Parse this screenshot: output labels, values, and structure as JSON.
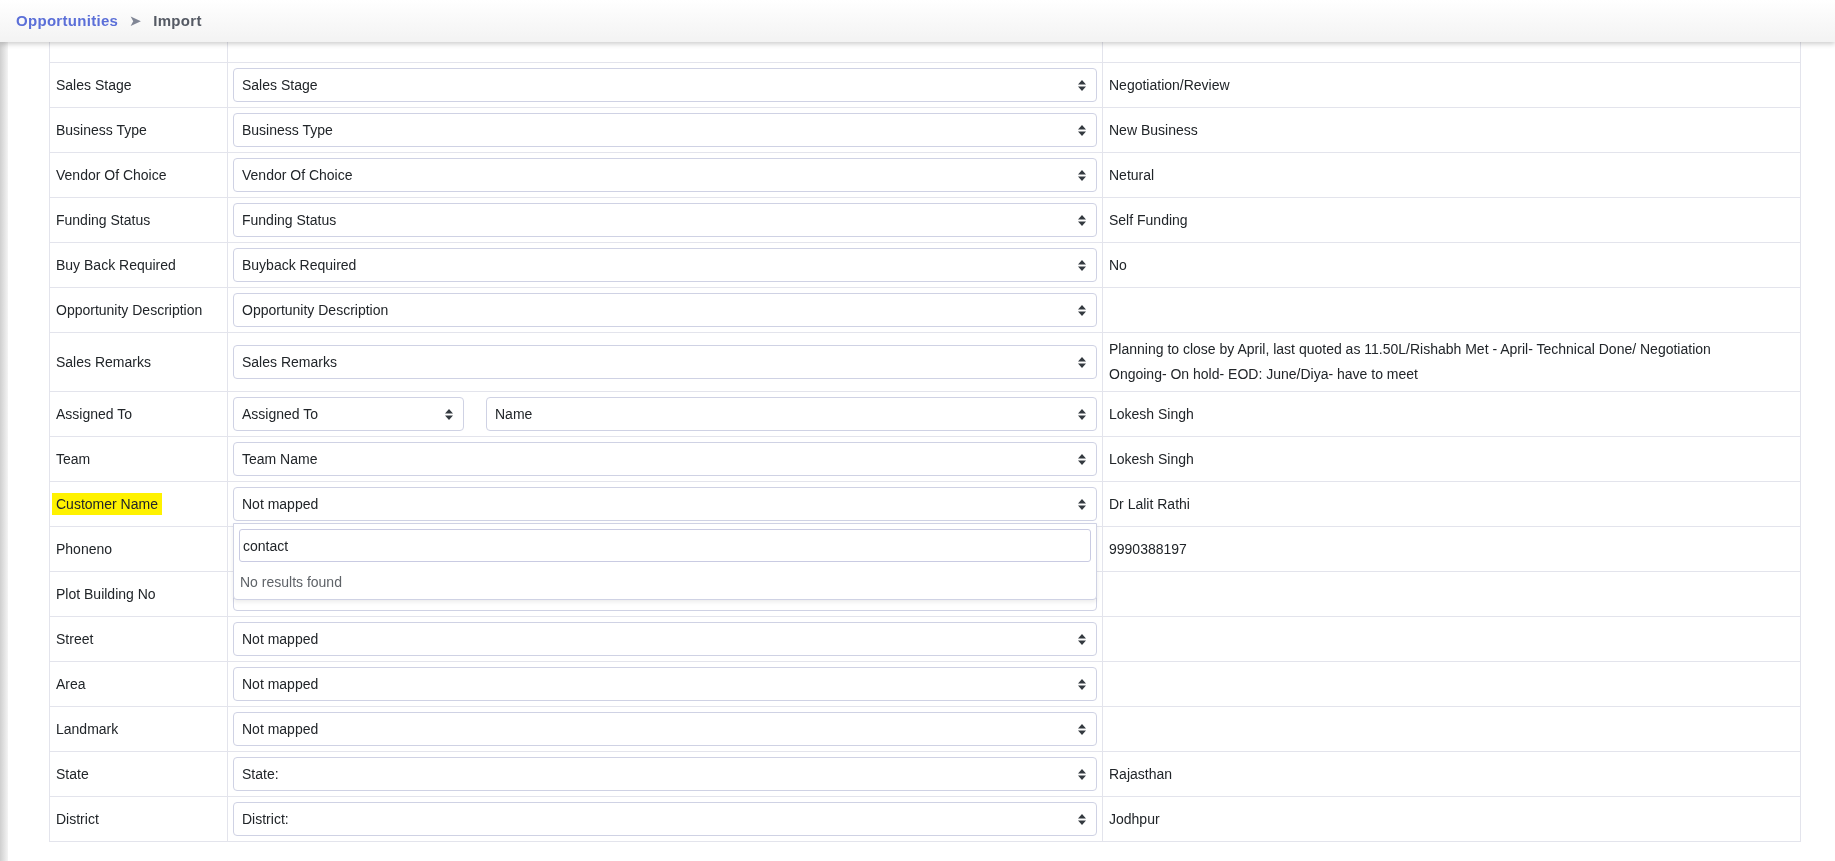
{
  "breadcrumb": [
    {
      "label": "Opportunities",
      "kind": "link"
    },
    {
      "label": "➤",
      "kind": "separator"
    },
    {
      "label": "Import",
      "kind": "current"
    }
  ],
  "rows": [
    {
      "label": "Sales Stage",
      "highlighted": false,
      "selects": [
        {
          "value": "Sales Stage"
        }
      ],
      "sample": "Negotiation/Review"
    },
    {
      "label": "Business Type",
      "highlighted": false,
      "selects": [
        {
          "value": "Business Type"
        }
      ],
      "sample": "New Business"
    },
    {
      "label": "Vendor Of Choice",
      "highlighted": false,
      "selects": [
        {
          "value": "Vendor Of Choice"
        }
      ],
      "sample": "Netural"
    },
    {
      "label": "Funding Status",
      "highlighted": false,
      "selects": [
        {
          "value": "Funding Status"
        }
      ],
      "sample": "Self Funding"
    },
    {
      "label": "Buy Back Required",
      "highlighted": false,
      "selects": [
        {
          "value": "Buyback Required"
        }
      ],
      "sample": "No"
    },
    {
      "label": "Opportunity Description",
      "highlighted": false,
      "selects": [
        {
          "value": "Opportunity Description"
        }
      ]
    },
    {
      "label": "Sales Remarks",
      "highlighted": false,
      "selects": [
        {
          "value": "Sales Remarks"
        }
      ],
      "sample": "Planning to close by April, last quoted as 11.50L/Rishabh Met - April- Technical Done/ Negotiation Ongoing- On hold- EOD: June/Diya- have to meet"
    },
    {
      "label": "Assigned To",
      "highlighted": false,
      "selects": [
        {
          "value": "Assigned To"
        },
        {
          "value": "Name"
        }
      ],
      "sample": "Lokesh Singh"
    },
    {
      "label": "Team",
      "highlighted": false,
      "selects": [
        {
          "value": "Team Name"
        }
      ],
      "sample": "Lokesh Singh"
    },
    {
      "label": "Customer Name",
      "highlighted": true,
      "selects": [
        {
          "value": "Not mapped",
          "dropdown": {
            "search": "contact",
            "message": "No results found"
          }
        }
      ],
      "sample": "Dr Lalit Rathi"
    },
    {
      "label": "Phoneno",
      "highlighted": false,
      "selects": [],
      "sample": "9990388197"
    },
    {
      "label": "Plot Building No",
      "highlighted": false,
      "selects": [
        {
          "kind": "select"
        }
      ]
    },
    {
      "label": "Street",
      "highlighted": false,
      "selects": [
        {
          "value": "Not mapped"
        }
      ]
    },
    {
      "label": "Area",
      "highlighted": false,
      "selects": [
        {
          "value": "Not mapped"
        }
      ]
    },
    {
      "label": "Landmark",
      "highlighted": false,
      "selects": [
        {
          "value": "Not mapped"
        }
      ]
    },
    {
      "label": "State",
      "highlighted": false,
      "selects": [
        {
          "value": "State:"
        }
      ],
      "sample": "Rajasthan"
    },
    {
      "label": "District",
      "highlighted": false,
      "selects": [
        {
          "value": "District:"
        }
      ],
      "sample": "Jodhpur"
    }
  ]
}
